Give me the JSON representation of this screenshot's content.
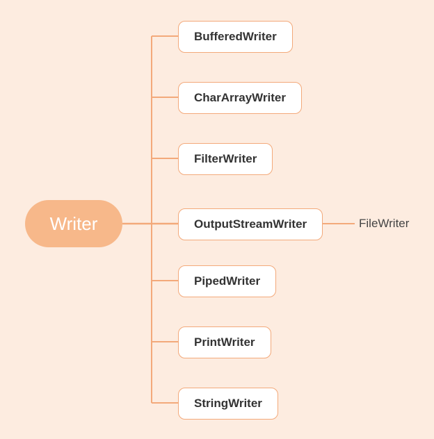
{
  "diagram": {
    "root": "Writer",
    "children": [
      "BufferedWriter",
      "CharArrayWriter",
      "FilterWriter",
      "OutputStreamWriter",
      "PipedWriter",
      "PrintWriter",
      "StringWriter"
    ],
    "grandchild": "FileWriter",
    "colors": {
      "background": "#fdece0",
      "rootFill": "#f7b88a",
      "rootText": "#ffffff",
      "nodeBorder": "#f3a97a",
      "nodeBg": "#ffffff",
      "connector": "#f3a97a",
      "leafConnector": "#f3a97a"
    }
  }
}
